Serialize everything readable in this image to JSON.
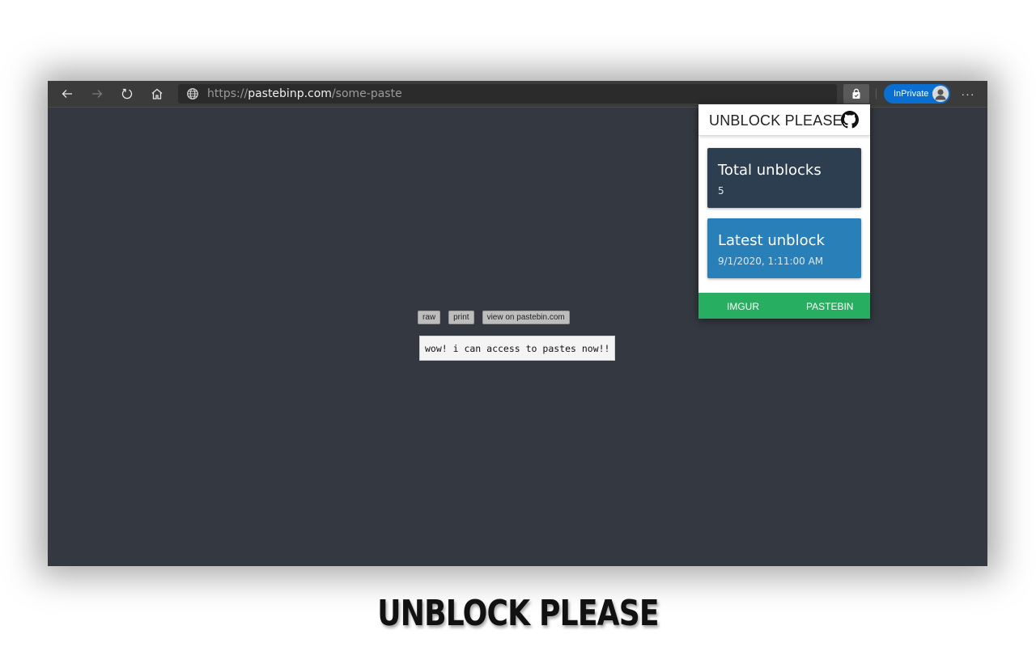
{
  "browser": {
    "url_scheme": "https://",
    "url_host": "pastebinp.com",
    "url_path": "/some-paste",
    "inprivate_label": "InPrivate",
    "more_label": "···"
  },
  "page": {
    "buttons": [
      "raw",
      "print",
      "view on pastebin.com"
    ],
    "paste_text": "wow! i can access to pastes now!!"
  },
  "popup": {
    "title": "UNBLOCK PLEASE",
    "total_title": "Total unblocks",
    "total_value": "5",
    "latest_title": "Latest unblock",
    "latest_value": "9/1/2020, 1:11:00 AM",
    "footer_left": "IMGUR",
    "footer_right": "PASTEBIN",
    "colors": {
      "card_dark": "#2c3e50",
      "card_blue": "#2980b9",
      "footer_green": "#27ae60"
    }
  },
  "caption": "UNBLOCK PLEASE",
  "icons": [
    "back-icon",
    "forward-icon",
    "refresh-icon",
    "home-icon",
    "globe-icon",
    "extension-lock-icon",
    "avatar",
    "more-icon",
    "github-icon"
  ]
}
